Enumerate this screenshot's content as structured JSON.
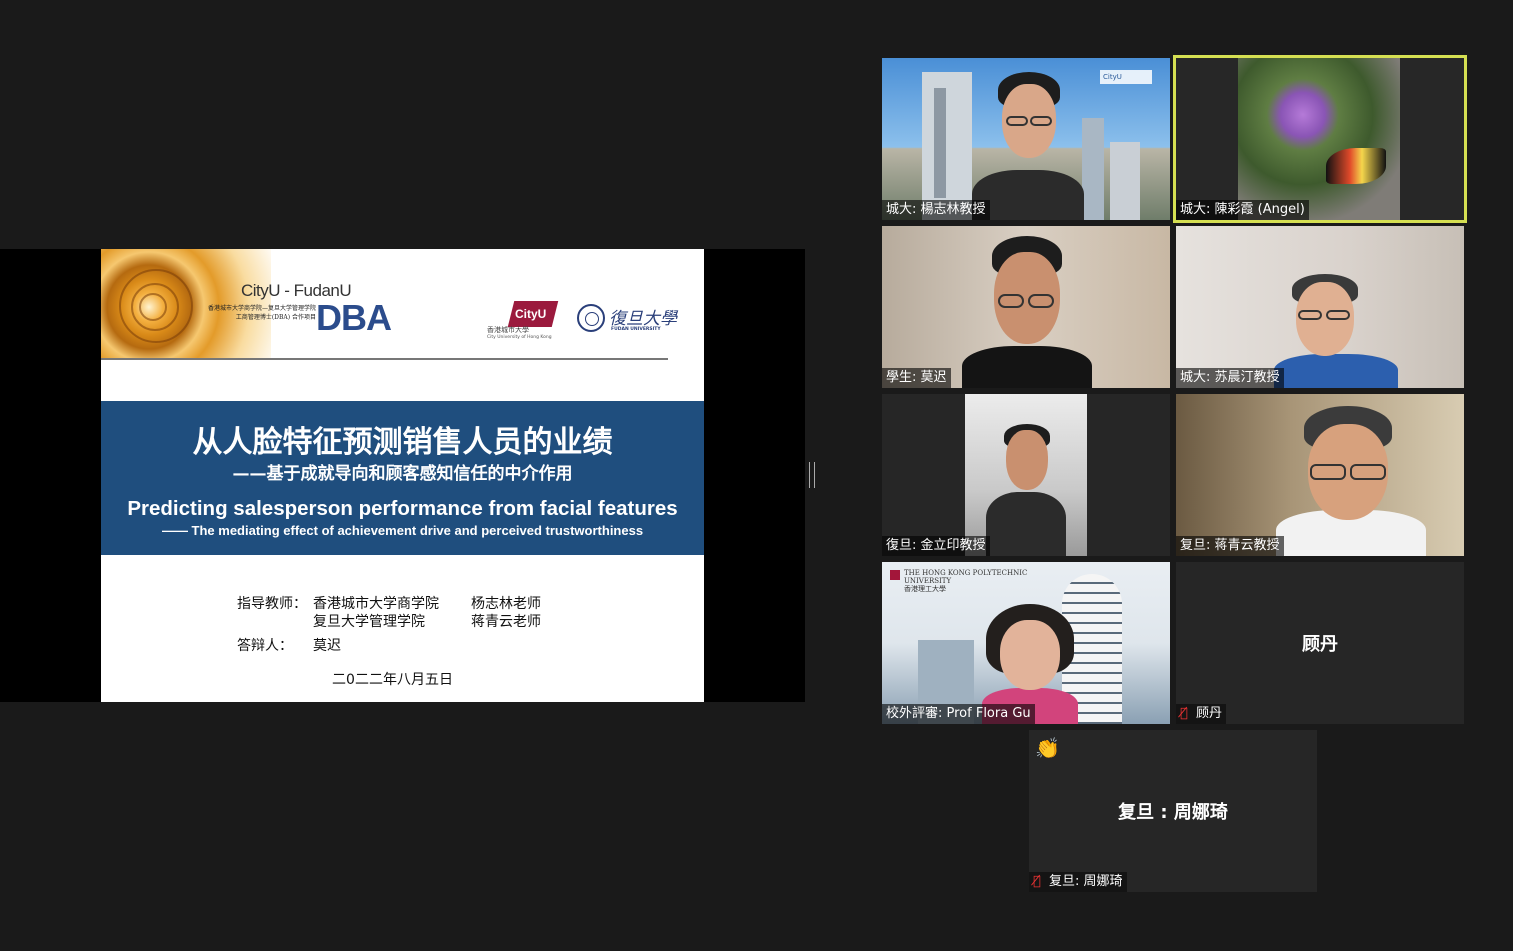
{
  "slide": {
    "dba_top": "CityU - FudanU",
    "dba_sub": "香港城市大学商学院—复旦大学管理学院 工商管理博士(DBA) 合作项目",
    "dba_big": "DBA",
    "cityu_flag": "CityU",
    "cityu_cn": "香港城市大學",
    "cityu_en": "City University of Hong Kong",
    "fudan_cn": "復旦大學",
    "fudan_en": "FUDAN UNIVERSITY",
    "title_cn": "从人脸特征预测销售人员的业绩",
    "subtitle_cn": "——基于成就导向和顾客感知信任的中介作用",
    "title_en": "Predicting salesperson performance from facial features",
    "subtitle_en": "—— The mediating effect of achievement drive and perceived trustworthiness",
    "advisor_label": "指导教师：",
    "advisor_school_1": "香港城市大学商学院",
    "advisor_name_1": "杨志林老师",
    "advisor_school_2": "复旦大学管理学院",
    "advisor_name_2": "蒋青云老师",
    "defender_label": "答辩人：",
    "defender_name": "莫迟",
    "date": "二0二二年八月五日"
  },
  "participants": [
    {
      "name": "城大: 楊志林教授",
      "muted": false,
      "video": true
    },
    {
      "name": "城大: 陳彩霞 (Angel)",
      "muted": false,
      "video": true,
      "active_speaker": true
    },
    {
      "name": "學生: 莫迟",
      "muted": false,
      "video": true
    },
    {
      "name": "城大: 苏晨汀教授",
      "muted": false,
      "video": true
    },
    {
      "name": "復旦: 金立印教授",
      "muted": false,
      "video": true
    },
    {
      "name": "复旦: 蒋青云教授",
      "muted": false,
      "video": true
    },
    {
      "name": "校外評審: Prof Flora Gu",
      "muted": false,
      "video": true
    },
    {
      "name": "顾丹",
      "display_name": "顾丹",
      "muted": true,
      "video": false
    },
    {
      "name": "复旦: 周娜琦",
      "display_name": "复旦 : 周娜琦",
      "muted": true,
      "video": false,
      "reaction": "👏"
    }
  ],
  "backgrounds": {
    "p1_brand": "CityU",
    "p7_brand": "THE HONG KONG POLYTECHNIC UNIVERSITY",
    "p7_brand_cn": "香港理工大學"
  },
  "colors": {
    "title_band": "#1f4e7e",
    "active_speaker_border": "#d5df52",
    "muted_icon": "#ee3333",
    "app_bg": "#1a1a1a"
  }
}
